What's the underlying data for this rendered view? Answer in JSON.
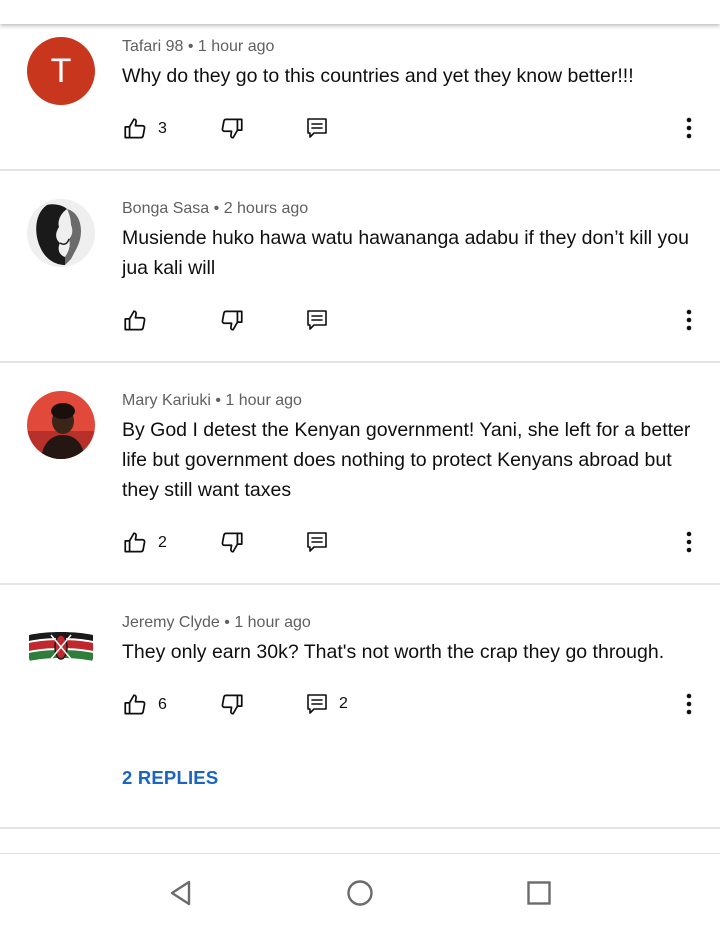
{
  "comments": [
    {
      "author": "Tafari 98",
      "time": "1 hour ago",
      "text": "Why do they go to this countries and yet they know better!!!",
      "avatar_letter": "T",
      "likes": "3",
      "replies": ""
    },
    {
      "author": "Bonga Sasa",
      "time": "2 hours ago",
      "text": "Musiende huko hawa watu hawananga adabu if they don’t kill you jua kali will",
      "likes": "",
      "replies": ""
    },
    {
      "author": "Mary Kariuki",
      "time": "1 hour ago",
      "text": "By God I detest the Kenyan government! Yani, she left for a better life but government does nothing to protect Kenyans abroad but they still want taxes",
      "likes": "2",
      "replies": ""
    },
    {
      "author": "Jeremy Clyde",
      "time": "1 hour ago",
      "text": "They only earn 30k? That's not worth the crap they go through.",
      "likes": "6",
      "replies": "2",
      "replies_link": "2 REPLIES"
    }
  ],
  "separator": " • ",
  "colors": {
    "accent": "#1a65c0",
    "avatar_t": "#c8361d",
    "meta_text": "#606060"
  },
  "icons": [
    "like-icon",
    "dislike-icon",
    "reply-icon",
    "more-vert-icon",
    "back-icon",
    "home-icon",
    "recents-icon"
  ]
}
